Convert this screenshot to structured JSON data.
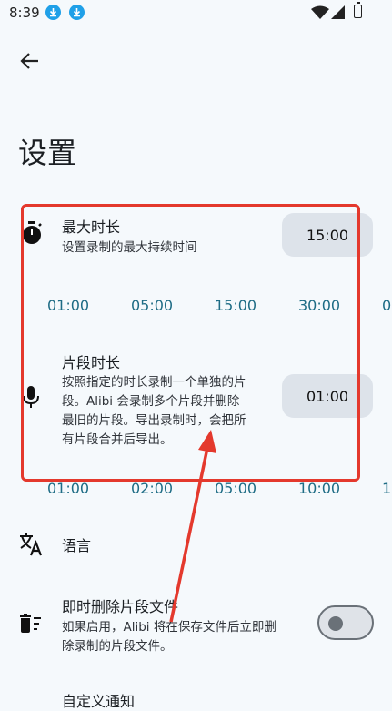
{
  "status_bar": {
    "time": "8:39"
  },
  "page": {
    "title": "设置"
  },
  "settings": {
    "max_duration": {
      "title": "最大时长",
      "description": "设置录制的最大持续时间",
      "value": "15:00",
      "options": [
        "01:00",
        "05:00",
        "15:00",
        "30:00",
        "0"
      ]
    },
    "segment_duration": {
      "title": "片段时长",
      "description_lines": [
        "按照指定的时长录制一个单独的片",
        "段。Alibi 会录制多个片段并删除",
        "最旧的片段。导出录制时，会把所",
        "有片段合并后导出。"
      ],
      "value": "01:00",
      "options": [
        "01:00",
        "02:00",
        "05:00",
        "10:00",
        "1"
      ]
    },
    "language": {
      "title": "语言"
    },
    "delete_segments": {
      "title": "即时删除片段文件",
      "description_lines": [
        "如果启用，Alibi 将在保存文件后立即删",
        "除录制的片段文件。"
      ],
      "enabled": false
    },
    "custom_notification": {
      "title": "自定义通知"
    }
  },
  "colors": {
    "accent": "#1e6c85",
    "annotation": "#e4392d",
    "download_badge": "#1fa0e8"
  }
}
